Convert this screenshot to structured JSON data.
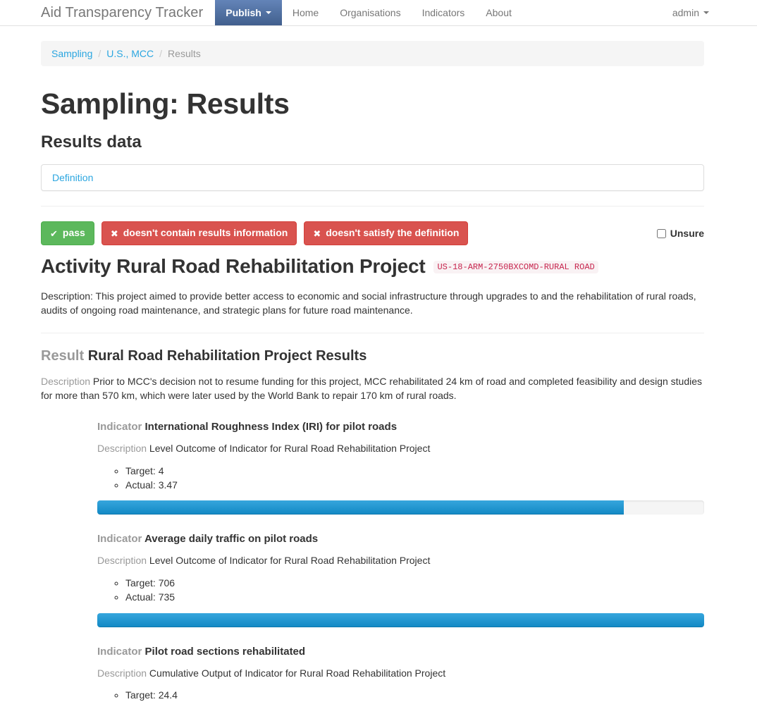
{
  "navbar": {
    "brand": "Aid Transparency Tracker",
    "items": [
      {
        "label": "Publish",
        "active": true,
        "has_caret": true
      },
      {
        "label": "Home",
        "active": false,
        "has_caret": false
      },
      {
        "label": "Organisations",
        "active": false,
        "has_caret": false
      },
      {
        "label": "Indicators",
        "active": false,
        "has_caret": false
      },
      {
        "label": "About",
        "active": false,
        "has_caret": false
      }
    ],
    "user": "admin"
  },
  "breadcrumb": {
    "items": [
      {
        "label": "Sampling",
        "link": true
      },
      {
        "label": "U.S., MCC",
        "link": true
      },
      {
        "label": "Results",
        "link": false
      }
    ],
    "separator": "/"
  },
  "page": {
    "title": "Sampling: Results",
    "section_title": "Results data"
  },
  "definition_panel": {
    "link_label": "Definition"
  },
  "actions": {
    "pass": {
      "label": "pass",
      "glyph": "✔",
      "color": "#5cb85c"
    },
    "no_results_info": {
      "label": "doesn't contain results information",
      "glyph": "✖",
      "color": "#d9534f"
    },
    "no_definition": {
      "label": "doesn't satisfy the definition",
      "glyph": "✖",
      "color": "#d9534f"
    },
    "unsure_label": "Unsure",
    "unsure_checked": false
  },
  "activity": {
    "prefix": "Activity",
    "title": "Rural Road Rehabilitation Project",
    "full_heading": "Activity Rural Road Rehabilitation Project",
    "identifier": "US-18-ARM-2750BXCOMD-RURAL ROAD",
    "description": "Description: This project aimed to provide better access to economic and social infrastructure through upgrades to and the rehabilitation of rural roads, audits of ongoing road maintenance, and strategic plans for future road maintenance."
  },
  "result": {
    "label": "Result",
    "title": "Rural Road Rehabilitation Project Results",
    "description_label": "Description",
    "description": "Prior to MCC's decision not to resume funding for this project, MCC rehabilitated 24 km of road and completed feasibility and design studies for more than 570 km, which were later used by the World Bank to repair 170 km of rural roads."
  },
  "indicator_labels": {
    "indicator": "Indicator",
    "description": "Description"
  },
  "indicators": [
    {
      "title": "International Roughness Index (IRI) for pilot roads",
      "description": "Level Outcome of Indicator for Rural Road Rehabilitation Project",
      "target_label": "Target: 4",
      "actual_label": "Actual: 3.47",
      "target": 4,
      "actual": 3.47,
      "progress_percent": 86.75
    },
    {
      "title": "Average daily traffic on pilot roads",
      "description": "Level Outcome of Indicator for Rural Road Rehabilitation Project",
      "target_label": "Target: 706",
      "actual_label": "Actual: 735",
      "target": 706,
      "actual": 735,
      "progress_percent": 100
    },
    {
      "title": "Pilot road sections rehabilitated",
      "description": "Cumulative Output of Indicator for Rural Road Rehabilitation Project",
      "target_label": "Target: 24.4",
      "actual_label": null,
      "target": 24.4,
      "actual": null,
      "progress_percent": null
    }
  ],
  "colors": {
    "brand_blue": "#2ba6e0",
    "nav_active_blue": "#43658f",
    "progress_blue": "#1188c4",
    "success_green": "#5cb85c",
    "danger_red": "#d9534f",
    "badge_pink_bg": "#f9f2f4",
    "badge_pink_text": "#c7254e",
    "muted_gray": "#999999"
  }
}
